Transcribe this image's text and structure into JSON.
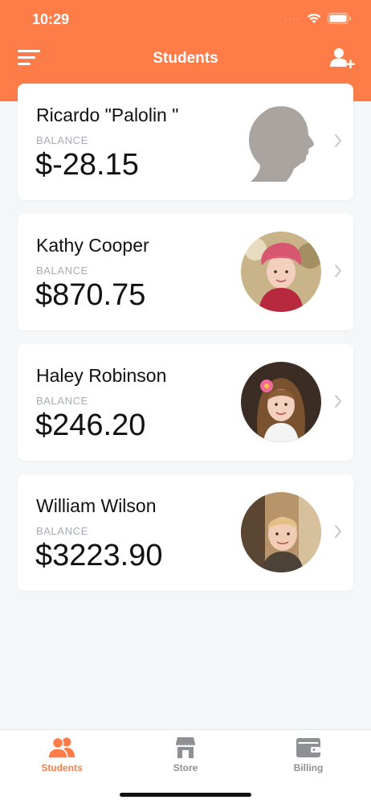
{
  "status_bar": {
    "time": "10:29",
    "signal": "····"
  },
  "header": {
    "title": "Students"
  },
  "students": [
    {
      "name": "Ricardo \"Palolin \"",
      "balance_label": "BALANCE",
      "balance": "$-28.15",
      "avatar": "silhouette"
    },
    {
      "name": "Kathy Cooper",
      "balance_label": "BALANCE",
      "balance": "$870.75",
      "avatar": "girl-red-hat-photo"
    },
    {
      "name": "Haley Robinson",
      "balance_label": "BALANCE",
      "balance": "$246.20",
      "avatar": "girl-pink-flower-photo"
    },
    {
      "name": "William Wilson",
      "balance_label": "BALANCE",
      "balance": "$3223.90",
      "avatar": "boy-blond-photo"
    }
  ],
  "tabs": [
    {
      "label": "Students",
      "icon": "users-icon",
      "active": true
    },
    {
      "label": "Store",
      "icon": "store-icon",
      "active": false
    },
    {
      "label": "Billing",
      "icon": "wallet-icon",
      "active": false
    }
  ],
  "colors": {
    "accent": "#fd7c47",
    "inactive": "#8e9094",
    "background": "#f5f6f8"
  }
}
